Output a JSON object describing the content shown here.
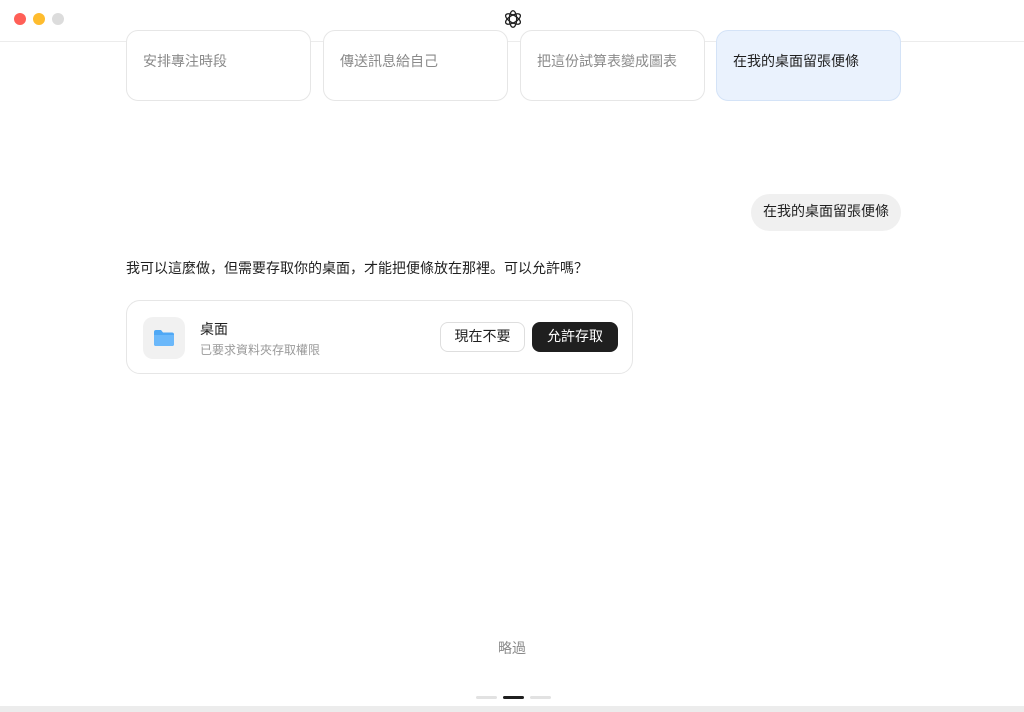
{
  "suggestions": [
    {
      "label": "安排專注時段"
    },
    {
      "label": "傳送訊息給自己"
    },
    {
      "label": "把這份試算表變成圖表"
    },
    {
      "label": "在我的桌面留張便條"
    }
  ],
  "chat": {
    "user_message": "在我的桌面留張便條",
    "assistant_message": "我可以這麼做，但需要存取你的桌面，才能把便條放在那裡。可以允許嗎？"
  },
  "permission": {
    "title": "桌面",
    "subtitle": "已要求資料夾存取權限",
    "deny_label": "現在不要",
    "allow_label": "允許存取",
    "icon": "folder-icon"
  },
  "footer": {
    "skip_label": "略過",
    "pager_active": 2,
    "pager_total": 3
  },
  "colors": {
    "accent_selected_bg": "#eaf2fd",
    "primary_button": "#1f1f1f",
    "folder_blue": "#4fa8f5"
  }
}
